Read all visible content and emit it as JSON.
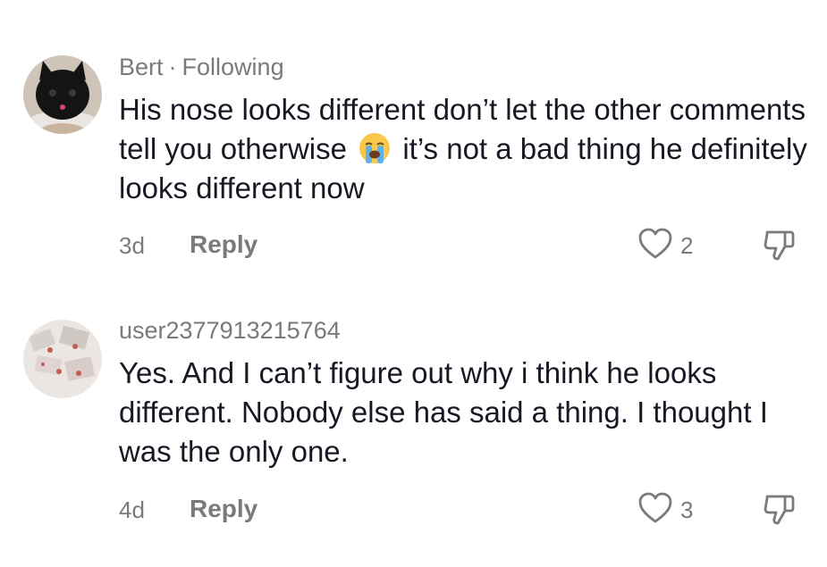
{
  "comments": [
    {
      "username": "Bert",
      "separator": "·",
      "relation": "Following",
      "text_before": "His nose looks different don’t let the other comments tell you otherwise",
      "emoji": "loudly-crying-face",
      "text_after": "it’s not a bad thing he definitely looks different now",
      "time": "3d",
      "reply_label": "Reply",
      "likes": "2"
    },
    {
      "username": "user2377913215764",
      "text": "Yes. And I can’t figure out why i think he looks different. Nobody else has said a thing. I thought I was the only one.",
      "time": "4d",
      "reply_label": "Reply",
      "likes": "3"
    }
  ],
  "icons": {
    "like": "heart-outline-icon",
    "dislike": "thumbs-down-icon"
  }
}
